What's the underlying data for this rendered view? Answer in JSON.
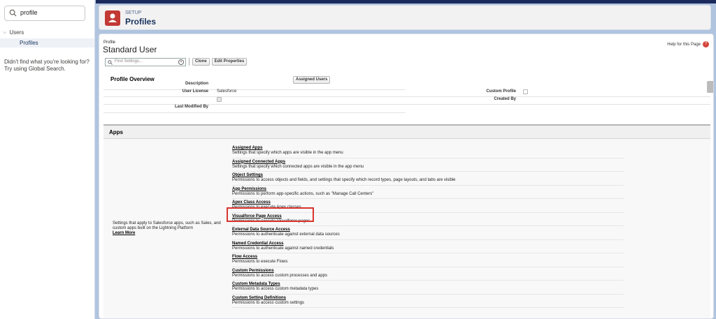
{
  "sidebar": {
    "search_value": "profile",
    "tree_group": "Users",
    "tree_item": "Profiles",
    "not_found": "Didn't find what you're looking for? Try using Global Search."
  },
  "header": {
    "eyebrow": "SETUP",
    "title": "Profiles"
  },
  "profile": {
    "breadcrumb": "Profile",
    "title": "Standard User",
    "help_link": "Help for this Page",
    "find_placeholder": "Find Settings...",
    "buttons": {
      "clone": "Clone",
      "edit_properties": "Edit Properties"
    }
  },
  "overview": {
    "title": "Profile Overview",
    "assigned_users_button": "Assigned Users",
    "fields": {
      "description_label": "Description",
      "user_license_label": "User License",
      "user_license_value": "Salesforce",
      "custom_profile_label": "Custom Profile",
      "custom_profile_checked": false,
      "created_by_label": "Created By",
      "last_modified_by_label": "Last Modified By",
      "checkbox_checked": true
    }
  },
  "apps": {
    "heading": "Apps",
    "description": "Settings that apply to Salesforce apps, such as Sales, and custom apps built on the Lightning Platform",
    "learn_more": "Learn More",
    "items": [
      {
        "title": "Assigned Apps",
        "desc": "Settings that specify which apps are visible in the app menu"
      },
      {
        "title": "Assigned Connected Apps",
        "desc": "Settings that specify which connected apps are visible in the app menu"
      },
      {
        "title": "Object Settings",
        "desc": "Permissions to access objects and fields, and settings that specify which record types, page layouts, and tabs are visible"
      },
      {
        "title": "App Permissions",
        "desc": "Permissions to perform app-specific actions, such as \"Manage Call Centers\""
      },
      {
        "title": "Apex Class Access",
        "desc": "Permissions to execute Apex classes"
      },
      {
        "title": "Visualforce Page Access",
        "desc": "Permissions to execute Visualforce pages"
      },
      {
        "title": "External Data Source Access",
        "desc": "Permissions to authenticate against external data sources"
      },
      {
        "title": "Named Credential Access",
        "desc": "Permissions to authenticate against named credentials"
      },
      {
        "title": "Flow Access",
        "desc": "Permissions to execute Flows"
      },
      {
        "title": "Custom Permissions",
        "desc": "Permissions to access custom processes and apps"
      },
      {
        "title": "Custom Metadata Types",
        "desc": "Permissions to access custom metadata types"
      },
      {
        "title": "Custom Setting Definitions",
        "desc": "Permissions to access custom settings"
      }
    ],
    "highlighted_item": "Apex Class Access"
  },
  "colors": {
    "accent_red": "#c23934",
    "highlight_border": "#d9332e",
    "top_bar": "#1b2a5c",
    "background": "#b0c4df"
  },
  "icons": [
    "search-icon",
    "chevron-down-icon",
    "profile-app-icon",
    "help-icon",
    "clear-icon"
  ]
}
